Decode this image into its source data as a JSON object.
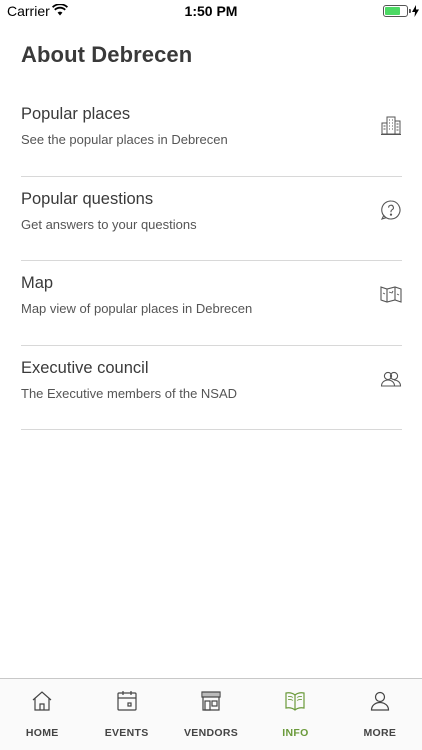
{
  "status_bar": {
    "carrier": "Carrier",
    "time": "1:50 PM",
    "battery_level": 0.7,
    "battery_color": "#4cd964"
  },
  "page": {
    "title": "About Debrecen"
  },
  "menu": [
    {
      "title": "Popular places",
      "subtitle": "See the popular places in Debrecen",
      "icon": "buildings-icon"
    },
    {
      "title": "Popular questions",
      "subtitle": "Get answers to your questions",
      "icon": "question-icon"
    },
    {
      "title": "Map",
      "subtitle": "Map view of popular places in Debrecen",
      "icon": "map-icon"
    },
    {
      "title": "Executive council",
      "subtitle": "The Executive members of the NSAD",
      "icon": "people-icon"
    }
  ],
  "tabs": [
    {
      "label": "HOME",
      "icon": "home-icon",
      "active": false
    },
    {
      "label": "EVENTS",
      "icon": "calendar-icon",
      "active": false
    },
    {
      "label": "VENDORS",
      "icon": "store-icon",
      "active": false
    },
    {
      "label": "INFO",
      "icon": "book-icon",
      "active": true
    },
    {
      "label": "MORE",
      "icon": "person-icon",
      "active": false
    }
  ],
  "colors": {
    "accent": "#6a9a3a",
    "text": "#3a3a3a",
    "divider": "#d8d8d8"
  }
}
